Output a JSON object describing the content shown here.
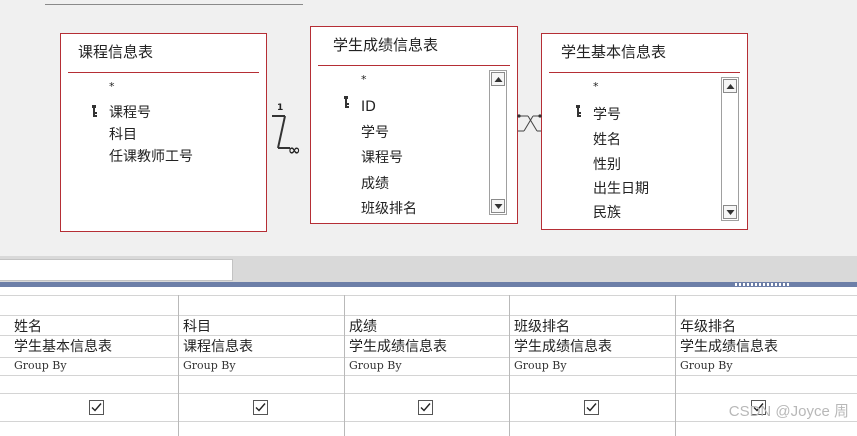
{
  "tables": {
    "course": {
      "title": "课程信息表",
      "fields": [
        "*",
        "课程号",
        "科目",
        "任课教师工号"
      ]
    },
    "score": {
      "title": "学生成绩信息表",
      "fields": [
        "*",
        "ID",
        "学号",
        "课程号",
        "成绩",
        "班级排名"
      ]
    },
    "student": {
      "title": "学生基本信息表",
      "fields": [
        "*",
        "学号",
        "姓名",
        "性别",
        "出生日期",
        "民族"
      ]
    }
  },
  "relationship": {
    "one": "1",
    "many": "∞"
  },
  "grid": {
    "columns": [
      {
        "field": "姓名",
        "table": "学生基本信息表",
        "total": "Group By",
        "show": true
      },
      {
        "field": "科目",
        "table": "课程信息表",
        "total": "Group By",
        "show": true
      },
      {
        "field": "成绩",
        "table": "学生成绩信息表",
        "total": "Group By",
        "show": true
      },
      {
        "field": "班级排名",
        "table": "学生成绩信息表",
        "total": "Group By",
        "show": true
      },
      {
        "field": "年级排名",
        "table": "学生成绩信息表",
        "total": "Group By",
        "show": true
      }
    ]
  },
  "watermark": "CSDN @Joyce 周",
  "colors": {
    "table_border": "#b52e35",
    "splitter": "#6d7fa8"
  },
  "icons": {
    "key": "key-icon",
    "scroll_up": "arrow-up-icon",
    "scroll_down": "arrow-down-icon",
    "checkbox": "checkmark-icon"
  }
}
